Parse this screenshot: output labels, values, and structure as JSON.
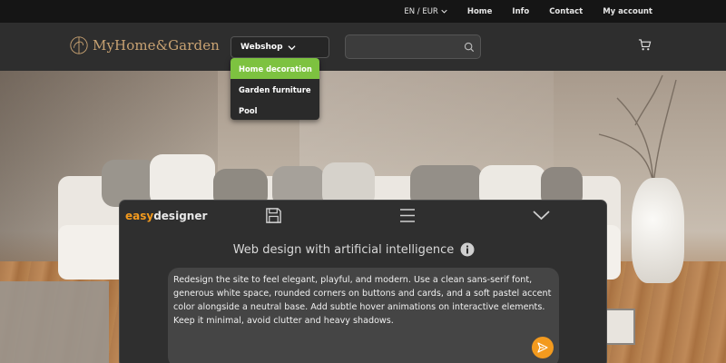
{
  "topbar": {
    "language": "EN / EUR",
    "links": [
      "Home",
      "Info",
      "Contact",
      "My account"
    ]
  },
  "header": {
    "logo_text": "MyHome&Garden",
    "webshop_label": "Webshop",
    "search_placeholder": ""
  },
  "dropdown": {
    "items": [
      "Home decoration",
      "Garden furniture",
      "Pool"
    ],
    "active_index": 0
  },
  "easydesigner": {
    "logo_easy": "easy",
    "logo_designer": "designer",
    "title": "Web design with artificial intelligence",
    "prompt": "Redesign the site to feel elegant, playful, and modern. Use a clean sans-serif font, generous white space, rounded corners on buttons and cards, and a soft pastel accent color alongside a neutral base. Add subtle hover animations on interactive elements. Keep it minimal, avoid clutter and heavy shadows."
  },
  "colors": {
    "accent_green": "#7dc240",
    "brand_gold": "#c8a272",
    "easy_orange": "#f39a1e"
  },
  "icons": [
    "chevron-down-icon",
    "search-icon",
    "cart-icon",
    "save-icon",
    "menu-icon",
    "collapse-icon",
    "info-icon",
    "send-icon",
    "logo-icon"
  ]
}
